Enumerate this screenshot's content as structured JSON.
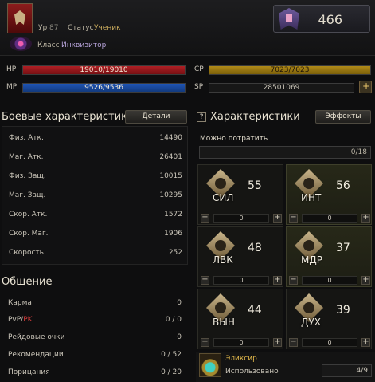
{
  "header": {
    "level_label": "Ур",
    "level_value": "87",
    "status_label": "Статус",
    "status_value": "Ученик",
    "class_label": "Класс",
    "class_value": "Инквизитор",
    "rank_value": "466"
  },
  "bars": {
    "hp": {
      "label": "HP",
      "value": "19010/19010",
      "fraction": 1.0
    },
    "mp": {
      "label": "MP",
      "value": "9526/9536",
      "fraction": 0.999
    },
    "cp": {
      "label": "CP",
      "value": "7023/7023",
      "fraction": 1.0
    },
    "sp": {
      "label": "SP",
      "value": "28501069"
    }
  },
  "combat": {
    "title": "Боевые характеристики",
    "details_button": "Детали",
    "rows": [
      {
        "label": "Физ. Атк.",
        "value": "14490"
      },
      {
        "label": "Маг. Атк.",
        "value": "26401"
      },
      {
        "label": "Физ. Защ.",
        "value": "10015"
      },
      {
        "label": "Маг. Защ.",
        "value": "10295"
      },
      {
        "label": "Скор. Атк.",
        "value": "1572"
      },
      {
        "label": "Скор. Маг.",
        "value": "1906"
      },
      {
        "label": "Скорость",
        "value": "252"
      }
    ]
  },
  "social": {
    "title": "Общение",
    "rows": [
      {
        "label": "Карма",
        "value": "0"
      },
      {
        "label_a": "PvP/",
        "label_b": "PK",
        "value": "0 / 0"
      },
      {
        "label": "Рейдовые очки",
        "value": "0"
      },
      {
        "label": "Рекомендации",
        "value": "0 / 52"
      },
      {
        "label": "Порицания",
        "value": "0 / 20"
      }
    ]
  },
  "attributes": {
    "title": "Характеристики",
    "help_icon": "?",
    "effects_button": "Эффекты",
    "spend_label": "Можно потратить",
    "spend_value": "0/18",
    "items": [
      {
        "label": "СИЛ",
        "value": "55",
        "increment": "0",
        "icon": "arm-icon"
      },
      {
        "label": "ИНТ",
        "value": "56",
        "increment": "0",
        "icon": "book-icon"
      },
      {
        "label": "ЛВК",
        "value": "48",
        "increment": "0",
        "icon": "foot-icon"
      },
      {
        "label": "МДР",
        "value": "37",
        "increment": "0",
        "icon": "feather-icon"
      },
      {
        "label": "ВЫН",
        "value": "44",
        "increment": "0",
        "icon": "heart-icon"
      },
      {
        "label": "ДУХ",
        "value": "39",
        "increment": "0",
        "icon": "spirit-icon"
      }
    ],
    "minus": "−",
    "plus": "+"
  },
  "elixir": {
    "name": "Эликсир",
    "used_label": "Использовано",
    "used_value": "4/9"
  }
}
